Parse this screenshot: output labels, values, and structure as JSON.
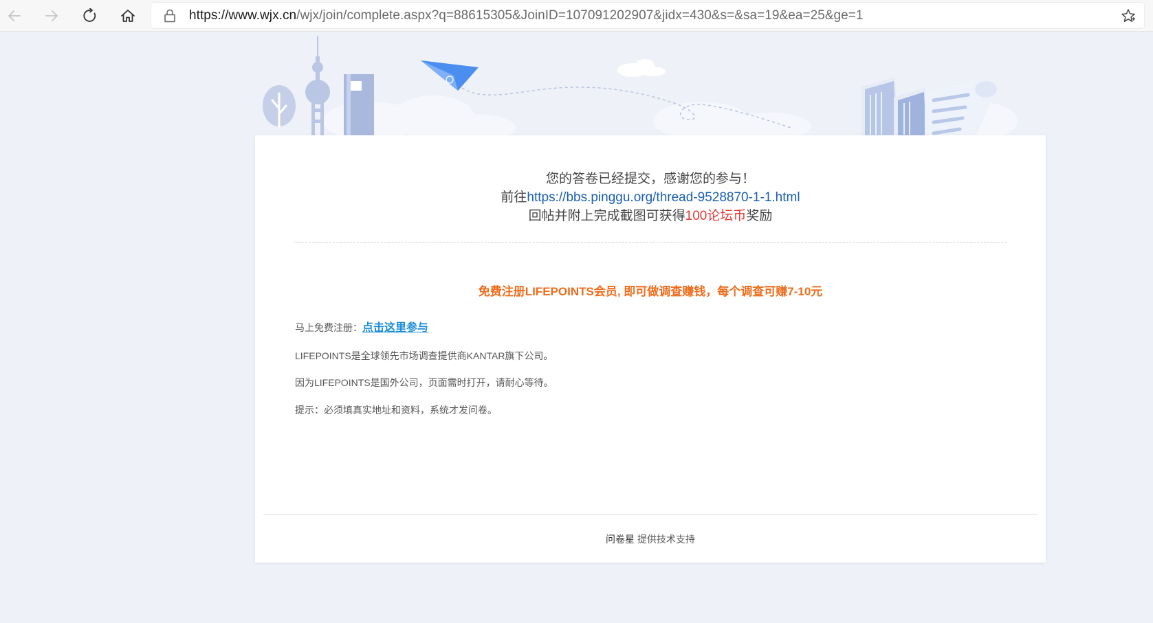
{
  "browser": {
    "back_icon": "arrow-left-icon",
    "forward_icon": "arrow-right-icon",
    "refresh_icon": "refresh-icon",
    "home_icon": "home-icon",
    "url_host": "https://www.wjx.cn",
    "url_rest": "/wjx/join/complete.aspx?q=88615305&JoinID=107091202907&jidx=430&s=&sa=19&ea=25&ge=1",
    "favorite_icon": "star-icon"
  },
  "page": {
    "thanks_line1": "您的答卷已经提交，感谢您的参与！",
    "thanks_line2_prefix": "前往",
    "thanks_line2_link": "https://bbs.pinggu.org/thread-9528870-1-1.html",
    "thanks_line3_prefix": "回帖并附上完成截图可获得",
    "thanks_line3_highlight": "100论坛币",
    "thanks_line3_suffix": "奖励",
    "promo_title": "免费注册LIFEPOINTS会员, 即可做调查赚钱，每个调查可赚7-10元",
    "register_label": "马上免费注册：",
    "register_link": "点击这里参与",
    "info1": "LIFEPOINTS是全球领先市场调查提供商KANTAR旗下公司。",
    "info2": "因为LIFEPOINTS是国外公司，页面需时打开，请耐心等待。",
    "info3": "提示：必须填真实地址和资料，系统才发问卷。",
    "footer_brand": "问卷星",
    "footer_text": " 提供技术支持"
  },
  "colors": {
    "link_blue": "#1a5fb4",
    "reward_red": "#e53935",
    "promo_orange": "#ef6c1b",
    "register_link_blue": "#1a8cd8",
    "page_background": "#eef1f8"
  }
}
